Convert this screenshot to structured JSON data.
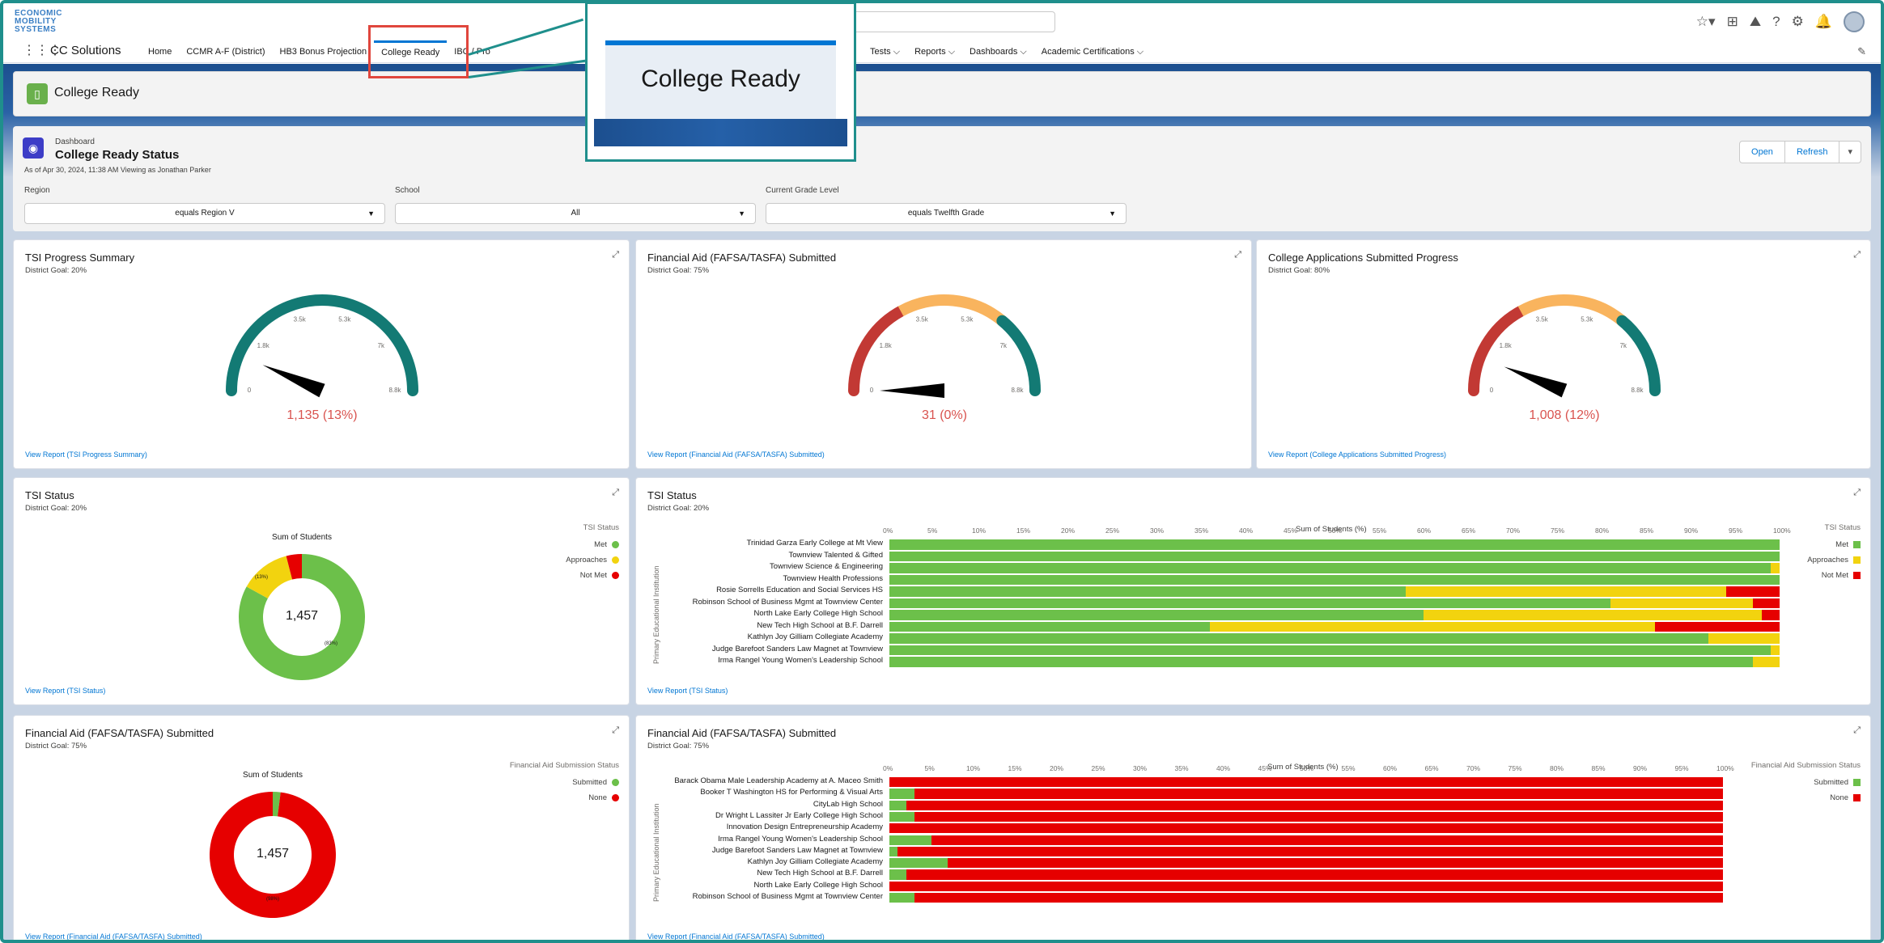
{
  "header": {
    "logo_text": "ECONOMIC MOBILITY SYSTEMS",
    "icons": [
      "favorites-icon",
      "add-icon",
      "trailhead-icon",
      "help-icon",
      "setup-gear-icon",
      "notifications-bell-icon",
      "avatar"
    ]
  },
  "nav": {
    "app_name": "CC Solutions",
    "items": [
      "Home",
      "CCMR A-F (District)",
      "HB3 Bonus Projection",
      "College Ready",
      "IBC / Pro"
    ],
    "items_right": [
      "Tests",
      "Reports",
      "Dashboards",
      "Academic Certifications"
    ]
  },
  "callout": {
    "label": "College Ready"
  },
  "page_header": {
    "title": "College Ready"
  },
  "dashboard": {
    "type_label": "Dashboard",
    "title": "College Ready Status",
    "subtitle": "As of Apr 30, 2024, 11:38 AM Viewing as Jonathan Parker",
    "buttons": {
      "open": "Open",
      "refresh": "Refresh",
      "more": "▾"
    },
    "filters": [
      {
        "label": "Region",
        "value": "equals Region V"
      },
      {
        "label": "School",
        "value": "All"
      },
      {
        "label": "Current Grade Level",
        "value": "equals Twelfth Grade"
      }
    ]
  },
  "gauges": [
    {
      "title": "TSI Progress Summary",
      "goal": "District Goal: 20%",
      "value": "1,135 (13%)",
      "ticks": [
        "0",
        "1.8k",
        "3.5k",
        "5.3k",
        "7k",
        "8.8k"
      ],
      "fraction": 0.13,
      "link": "View Report (TSI Progress Summary)",
      "bands": [
        "#137a74"
      ]
    },
    {
      "title": "Financial Aid (FAFSA/TASFA) Submitted",
      "goal": "District Goal: 75%",
      "value": "31 (0%)",
      "ticks": [
        "0",
        "1.8k",
        "3.5k",
        "5.3k",
        "7k",
        "8.8k"
      ],
      "fraction": 0.0,
      "link": "View Report (Financial Aid (FAFSA/TASFA) Submitted)",
      "bands": [
        "#c23934",
        "#f9b45e",
        "#137a74"
      ]
    },
    {
      "title": "College Applications Submitted Progress",
      "goal": "District Goal: 80%",
      "value": "1,008 (12%)",
      "ticks": [
        "0",
        "1.8k",
        "3.5k",
        "5.3k",
        "7k",
        "8.8k"
      ],
      "fraction": 0.12,
      "link": "View Report (College Applications Submitted Progress)",
      "bands": [
        "#c23934",
        "#f9b45e",
        "#137a74"
      ]
    }
  ],
  "tsi_donut": {
    "title": "TSI Status",
    "goal": "District Goal: 20%",
    "chart_title": "Sum of Students",
    "center": "1,457",
    "legend_title": "TSI Status",
    "legend": [
      {
        "label": "Met",
        "color": "#6cc04a"
      },
      {
        "label": "Approaches",
        "color": "#f2d30f"
      },
      {
        "label": "Not Met",
        "color": "#e60000"
      }
    ],
    "values": [
      0.83,
      0.13,
      0.04
    ],
    "slice_labels": [
      "(83%)",
      "(13%)"
    ],
    "link": "View Report (TSI Status)"
  },
  "tsi_bar": {
    "title": "TSI Status",
    "goal": "District Goal: 20%",
    "x_title": "Sum of Students (%)",
    "y_title": "Primary Educational Institution",
    "legend_title": "TSI Status",
    "legend": [
      {
        "label": "Met",
        "color": "#6cc04a"
      },
      {
        "label": "Approaches",
        "color": "#f2d30f"
      },
      {
        "label": "Not Met",
        "color": "#e60000"
      }
    ],
    "ticks": [
      "0%",
      "5%",
      "10%",
      "15%",
      "20%",
      "25%",
      "30%",
      "35%",
      "40%",
      "45%",
      "50%",
      "55%",
      "60%",
      "65%",
      "70%",
      "75%",
      "80%",
      "85%",
      "90%",
      "95%",
      "100%"
    ],
    "link": "View Report (TSI Status)"
  },
  "fa_donut": {
    "title": "Financial Aid (FAFSA/TASFA) Submitted",
    "goal": "District Goal: 75%",
    "chart_title": "Sum of Students",
    "center": "1,457",
    "legend_title": "Financial Aid Submission Status",
    "legend": [
      {
        "label": "Submitted",
        "color": "#6cc04a"
      },
      {
        "label": "None",
        "color": "#e60000"
      }
    ],
    "values": [
      0.02,
      0.98
    ],
    "slice_labels": [
      "(98%)"
    ],
    "link": "View Report (Financial Aid (FAFSA/TASFA) Submitted)"
  },
  "fa_bar": {
    "title": "Financial Aid (FAFSA/TASFA) Submitted",
    "goal": "District Goal: 75%",
    "x_title": "Sum of Students (%)",
    "y_title": "Primary Educational Institution",
    "legend_title": "Financial Aid Submission Status",
    "legend": [
      {
        "label": "Submitted",
        "color": "#6cc04a"
      },
      {
        "label": "None",
        "color": "#e60000"
      }
    ],
    "ticks": [
      "0%",
      "5%",
      "10%",
      "15%",
      "20%",
      "25%",
      "30%",
      "35%",
      "40%",
      "45%",
      "50%",
      "55%",
      "60%",
      "65%",
      "70%",
      "75%",
      "80%",
      "85%",
      "90%",
      "95%",
      "100%"
    ],
    "link": "View Report (Financial Aid (FAFSA/TASFA) Submitted)"
  },
  "chart_data": [
    {
      "type": "bar",
      "title": "Sum of Students (%)",
      "xlabel": "Sum of Students (%)",
      "ylabel": "Primary Educational Institution",
      "categories": [
        "Trinidad Garza Early College at Mt View",
        "Townview Talented & Gifted",
        "Townview Science & Engineering",
        "Townview Health Professions",
        "Rosie Sorrells Education and Social Services HS",
        "Robinson School of Business Mgmt at Townview Center",
        "North Lake Early College High School",
        "New Tech High School at B.F. Darrell",
        "Kathlyn Joy Gilliam Collegiate Academy",
        "Judge Barefoot Sanders Law Magnet at Townview",
        "Irma Rangel Young Women's Leadership School"
      ],
      "series": [
        {
          "name": "Met",
          "values": [
            100,
            100,
            99,
            100,
            58,
            81,
            60,
            36,
            92,
            99,
            97
          ]
        },
        {
          "name": "Approaches",
          "values": [
            0,
            0,
            1,
            0,
            36,
            16,
            38,
            50,
            8,
            1,
            3
          ]
        },
        {
          "name": "Not Met",
          "values": [
            0,
            0,
            0,
            0,
            6,
            3,
            2,
            14,
            0,
            0,
            0
          ]
        }
      ],
      "xlim": [
        0,
        100
      ]
    },
    {
      "type": "bar",
      "title": "Sum of Students (%)",
      "xlabel": "Sum of Students (%)",
      "ylabel": "Primary Educational Institution",
      "categories": [
        "Barack Obama Male Leadership Academy at A. Maceo Smith",
        "Booker T Washington HS for Performing & Visual Arts",
        "CityLab High School",
        "Dr Wright L Lassiter Jr Early College High School",
        "Innovation Design Entrepreneurship Academy",
        "Irma Rangel Young Women's Leadership School",
        "Judge Barefoot Sanders Law Magnet at Townview",
        "Kathlyn Joy Gilliam Collegiate Academy",
        "New Tech High School at B.F. Darrell",
        "North Lake Early College High School",
        "Robinson School of Business Mgmt at Townview Center"
      ],
      "series": [
        {
          "name": "Submitted",
          "values": [
            0,
            3,
            2,
            3,
            0,
            5,
            1,
            7,
            2,
            0,
            3
          ]
        },
        {
          "name": "None",
          "values": [
            100,
            97,
            98,
            97,
            100,
            95,
            99,
            93,
            98,
            100,
            97
          ]
        }
      ],
      "xlim": [
        0,
        100
      ]
    }
  ]
}
